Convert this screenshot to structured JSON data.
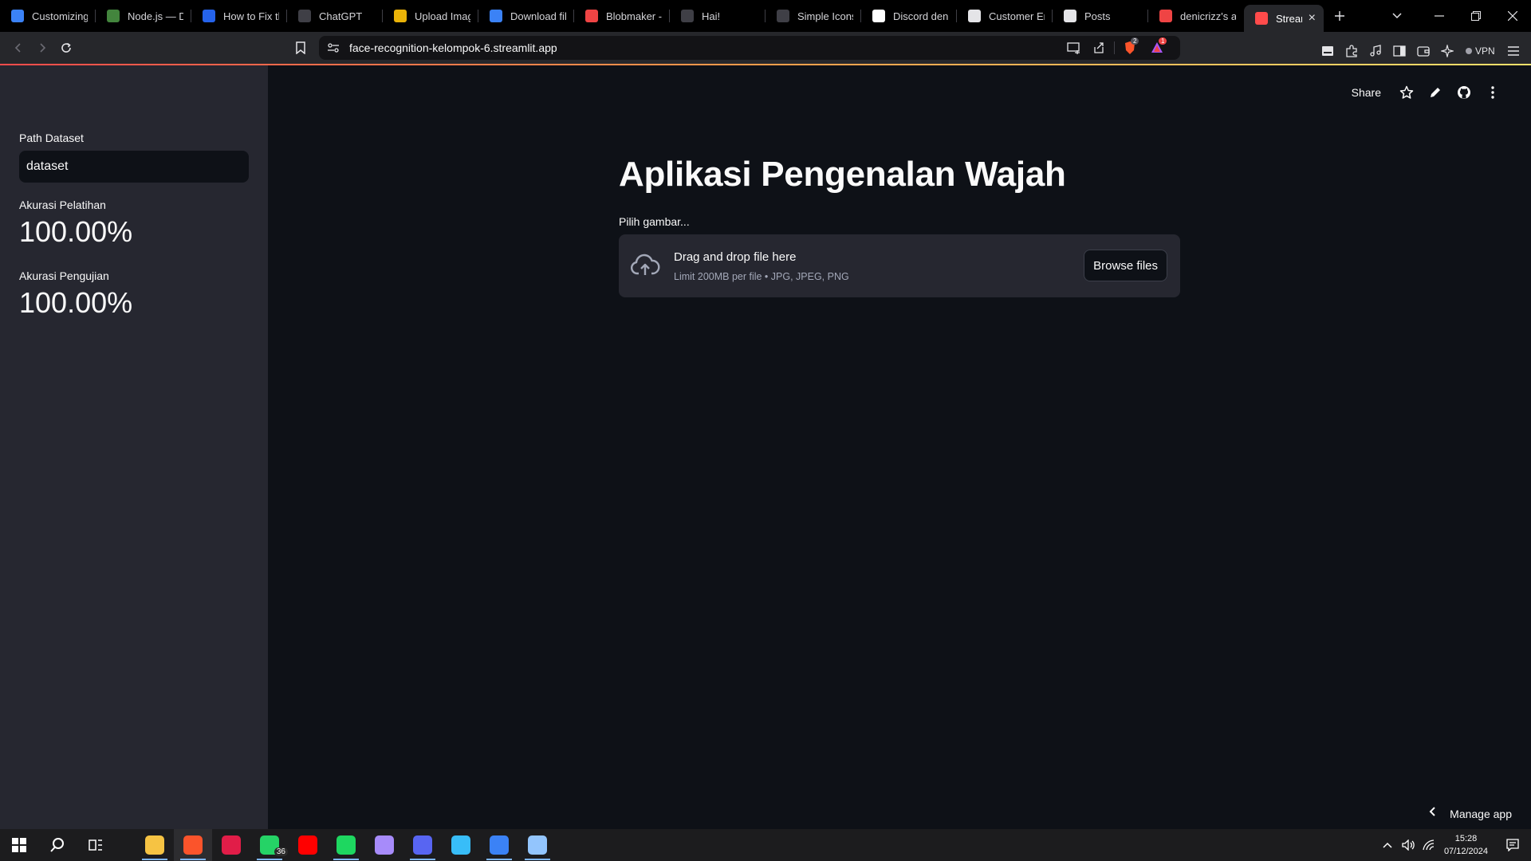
{
  "browser": {
    "tabs": [
      {
        "label": "Customizing",
        "icon": "wave-icon",
        "color": "#3b82f6"
      },
      {
        "label": "Node.js — Do",
        "icon": "nodejs-icon",
        "color": "#43853d"
      },
      {
        "label": "How to Fix th",
        "icon": "globe-icon",
        "color": "#2563eb"
      },
      {
        "label": "ChatGPT",
        "icon": "chatgpt-icon",
        "color": "#3f3f46"
      },
      {
        "label": "Upload Imag",
        "icon": "upload-icon",
        "color": "#eab308"
      },
      {
        "label": "Download fil",
        "icon": "diamond-icon",
        "color": "#3b82f6"
      },
      {
        "label": "Blobmaker - I",
        "icon": "blob-icon",
        "color": "#ef4444"
      },
      {
        "label": "Hai!",
        "icon": "chatgpt-icon",
        "color": "#3f3f46"
      },
      {
        "label": "Simple Icons",
        "icon": "simpleicons-icon",
        "color": "#3f3f46"
      },
      {
        "label": "Discord deni",
        "icon": "google-icon",
        "color": "#ffffff"
      },
      {
        "label": "Customer En",
        "icon": "notion-icon",
        "color": "#e4e4e7"
      },
      {
        "label": "Posts",
        "icon": "notion-icon",
        "color": "#e4e4e7"
      },
      {
        "label": "denicrizz's ap",
        "icon": "streamlit-icon",
        "color": "#ef4444"
      },
      {
        "label": "Streamlit",
        "icon": "streamlit-icon",
        "color": "#ff4b4b",
        "active": true
      }
    ],
    "url": "face-recognition-kelompok-6.streamlit.app",
    "brave_badge": "2",
    "rewards_badge": "1",
    "vpn_label": "VPN"
  },
  "sidebar": {
    "dataset_label": "Path Dataset",
    "dataset_value": "dataset",
    "train_label": "Akurasi Pelatihan",
    "train_value": "100.00%",
    "test_label": "Akurasi Pengujian",
    "test_value": "100.00%"
  },
  "header": {
    "share_label": "Share"
  },
  "main": {
    "title": "Aplikasi Pengenalan Wajah",
    "uploader_label": "Pilih gambar...",
    "drop_title": "Drag and drop file here",
    "drop_subtitle": "Limit 200MB per file • JPG, JPEG, PNG",
    "browse_label": "Browse files",
    "manage_label": "Manage app"
  },
  "taskbar": {
    "apps": [
      {
        "name": "file-explorer-icon",
        "color": "#f6c343",
        "running": true
      },
      {
        "name": "brave-icon",
        "color": "#fb542b",
        "running": true,
        "active": true
      },
      {
        "name": "opera-icon",
        "color": "#e11d48"
      },
      {
        "name": "whatsapp-icon",
        "color": "#25d366",
        "running": true,
        "badge": "36"
      },
      {
        "name": "youtube-icon",
        "color": "#ff0000"
      },
      {
        "name": "spotify-icon",
        "color": "#1ed760",
        "running": true
      },
      {
        "name": "paint-icon",
        "color": "#a78bfa"
      },
      {
        "name": "discord-icon",
        "color": "#5865f2",
        "running": true
      },
      {
        "name": "remote-desktop-icon",
        "color": "#38bdf8"
      },
      {
        "name": "vscode-icon",
        "color": "#3b82f6",
        "running": true
      },
      {
        "name": "paint-app-icon",
        "color": "#93c5fd",
        "running": true
      }
    ],
    "time": "15:28",
    "date": "07/12/2024"
  },
  "colors": {
    "app_bg": "#0e1117",
    "sidebar_bg": "#262730",
    "accent": "#ff4b4b"
  }
}
